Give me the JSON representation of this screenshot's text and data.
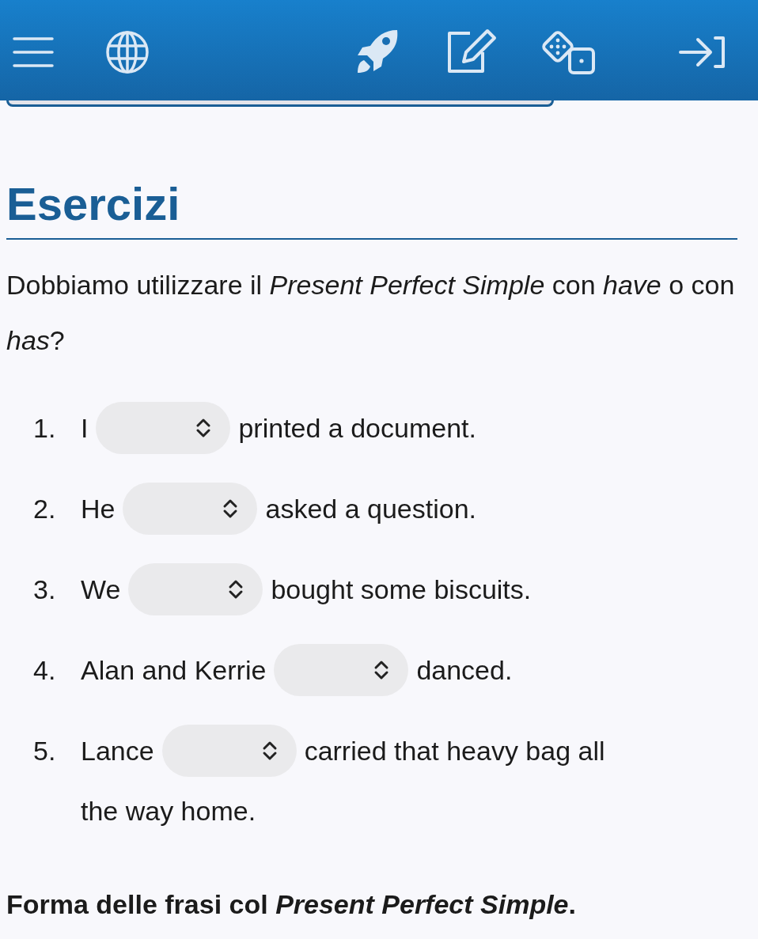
{
  "title": "Esercizi",
  "intro": "Dobbiamo utilizzare il *Present Perfect Simple* con *have* o con *has*?",
  "questions": [
    {
      "number": "1.",
      "before": "I",
      "after": [
        "printed a document."
      ]
    },
    {
      "number": "2.",
      "before": "He",
      "after": [
        "asked a question."
      ]
    },
    {
      "number": "3.",
      "before": "We",
      "after": [
        "bought some biscuits."
      ]
    },
    {
      "number": "4.",
      "before": "Alan and Kerrie",
      "after": [
        "danced."
      ]
    },
    {
      "number": "5.",
      "before": "Lance",
      "after": [
        "carried that heavy bag all",
        "the way home."
      ]
    }
  ],
  "footer": "Forma delle frasi col *Present Perfect Simple*."
}
